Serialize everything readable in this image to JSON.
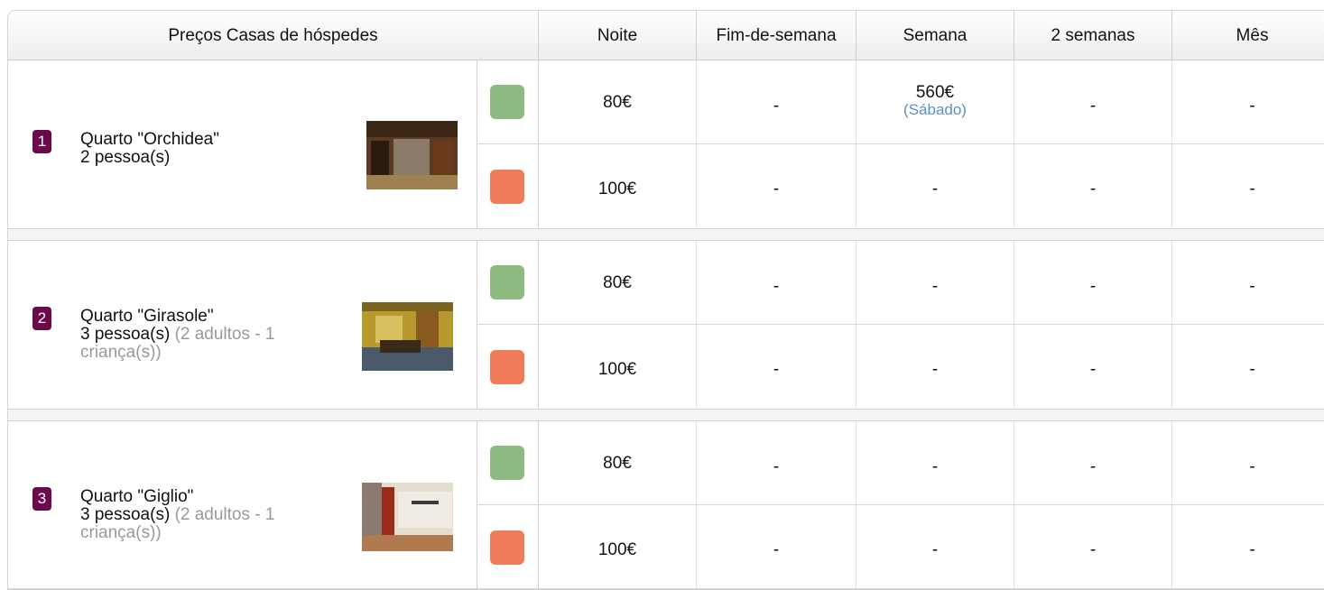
{
  "header": {
    "title": "Preços Casas de hóspedes",
    "columns": [
      "Noite",
      "Fim-de-semana",
      "Semana",
      "2 semanas",
      "Mês"
    ]
  },
  "colors": {
    "badge": "#6b0a4a",
    "low_season": "#8fbb82",
    "high_season": "#ef7b58",
    "note": "#5b8fc7"
  },
  "rooms": [
    {
      "number": "1",
      "name": "Quarto \"Orchidea\"",
      "capacity": "2 pessoa(s)",
      "detail": "",
      "rates": [
        {
          "season_color": "green",
          "values": [
            "80€",
            "-",
            "560€",
            "-",
            "-"
          ],
          "week_note": "(Sábado)"
        },
        {
          "season_color": "orange",
          "values": [
            "100€",
            "-",
            "-",
            "-",
            "-"
          ]
        }
      ]
    },
    {
      "number": "2",
      "name": "Quarto \"Girasole\"",
      "capacity": "3 pessoa(s)",
      "detail": "(2 adultos - 1 criança(s))",
      "rates": [
        {
          "season_color": "green",
          "values": [
            "80€",
            "-",
            "-",
            "-",
            "-"
          ]
        },
        {
          "season_color": "orange",
          "values": [
            "100€",
            "-",
            "-",
            "-",
            "-"
          ]
        }
      ]
    },
    {
      "number": "3",
      "name": "Quarto \"Giglio\"",
      "capacity": "3 pessoa(s)",
      "detail": "(2 adultos - 1 criança(s))",
      "rates": [
        {
          "season_color": "green",
          "values": [
            "80€",
            "-",
            "-",
            "-",
            "-"
          ]
        },
        {
          "season_color": "orange",
          "values": [
            "100€",
            "-",
            "-",
            "-",
            "-"
          ]
        }
      ]
    }
  ]
}
